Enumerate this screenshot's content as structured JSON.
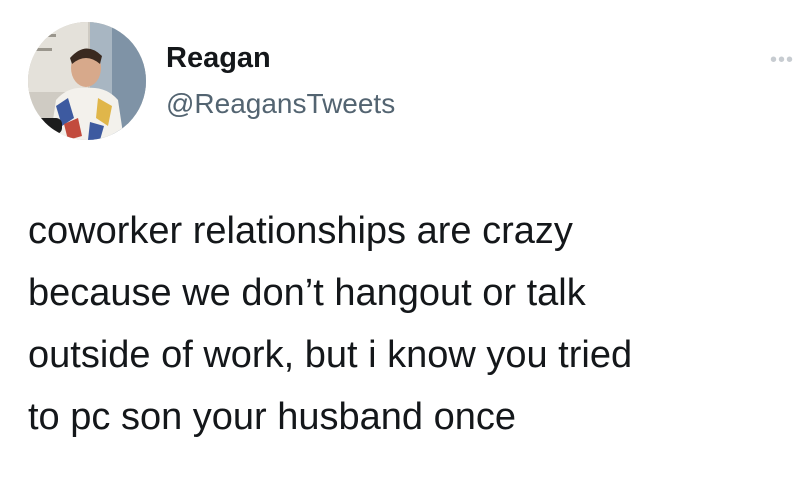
{
  "tweet": {
    "author": {
      "display_name": "Reagan",
      "handle": "@ReagansTweets",
      "avatar_icon": "profile-photo-icon"
    },
    "more_icon": "ellipsis-icon",
    "text_lines": [
      "coworker relationships are crazy",
      "because we don’t hangout or talk",
      "outside of work, but i know you tried",
      "to pc  son your husband once"
    ]
  }
}
